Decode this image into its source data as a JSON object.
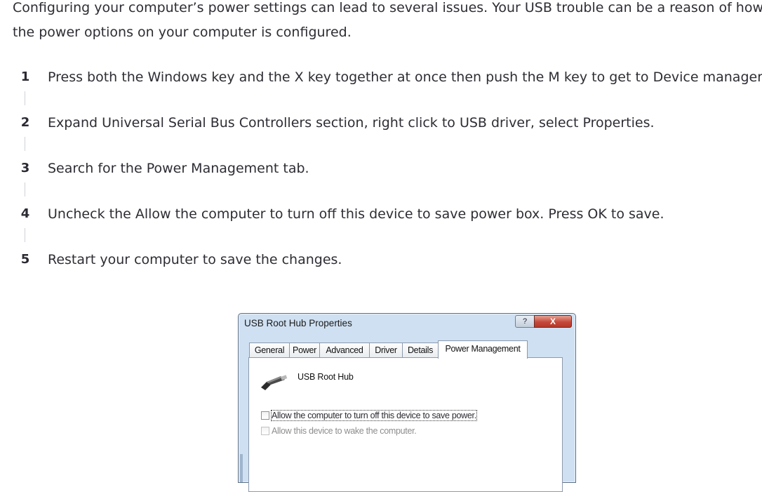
{
  "intro": "Configuring your computer’s power settings can lead to several issues. Your USB trouble can be a reason of how the power options on your computer is configured.",
  "steps": [
    {
      "number": "1",
      "text": "Press both the Windows key and the X key together at once then push the M key to get to Device manager."
    },
    {
      "number": "2",
      "text": "Expand Universal Serial Bus Controllers section, right click to USB driver, select Properties."
    },
    {
      "number": "3",
      "text": "Search for the Power Management tab."
    },
    {
      "number": "4",
      "text": "Uncheck the Allow the computer to turn off this device to save power box. Press OK to save."
    },
    {
      "number": "5",
      "text": "Restart your computer to save the changes."
    }
  ],
  "dialog": {
    "title": "USB Root Hub Properties",
    "help_label": "?",
    "close_label": "X",
    "tabs": [
      "General",
      "Power",
      "Advanced",
      "Driver",
      "Details",
      "Power Management"
    ],
    "active_tab": "Power Management",
    "device_name": "USB Root Hub",
    "device_icon": "usb-plug-icon",
    "options": [
      {
        "label": "Allow the computer to turn off this device to save power.",
        "checked": false,
        "enabled": true
      },
      {
        "label": "Allow this device to wake the computer.",
        "checked": false,
        "enabled": false
      }
    ]
  },
  "colors": {
    "text": "#2d2d34",
    "connector": "#cfd2d8",
    "dialog_frame": "#cfe0f2",
    "close_button": "#c5483a"
  }
}
